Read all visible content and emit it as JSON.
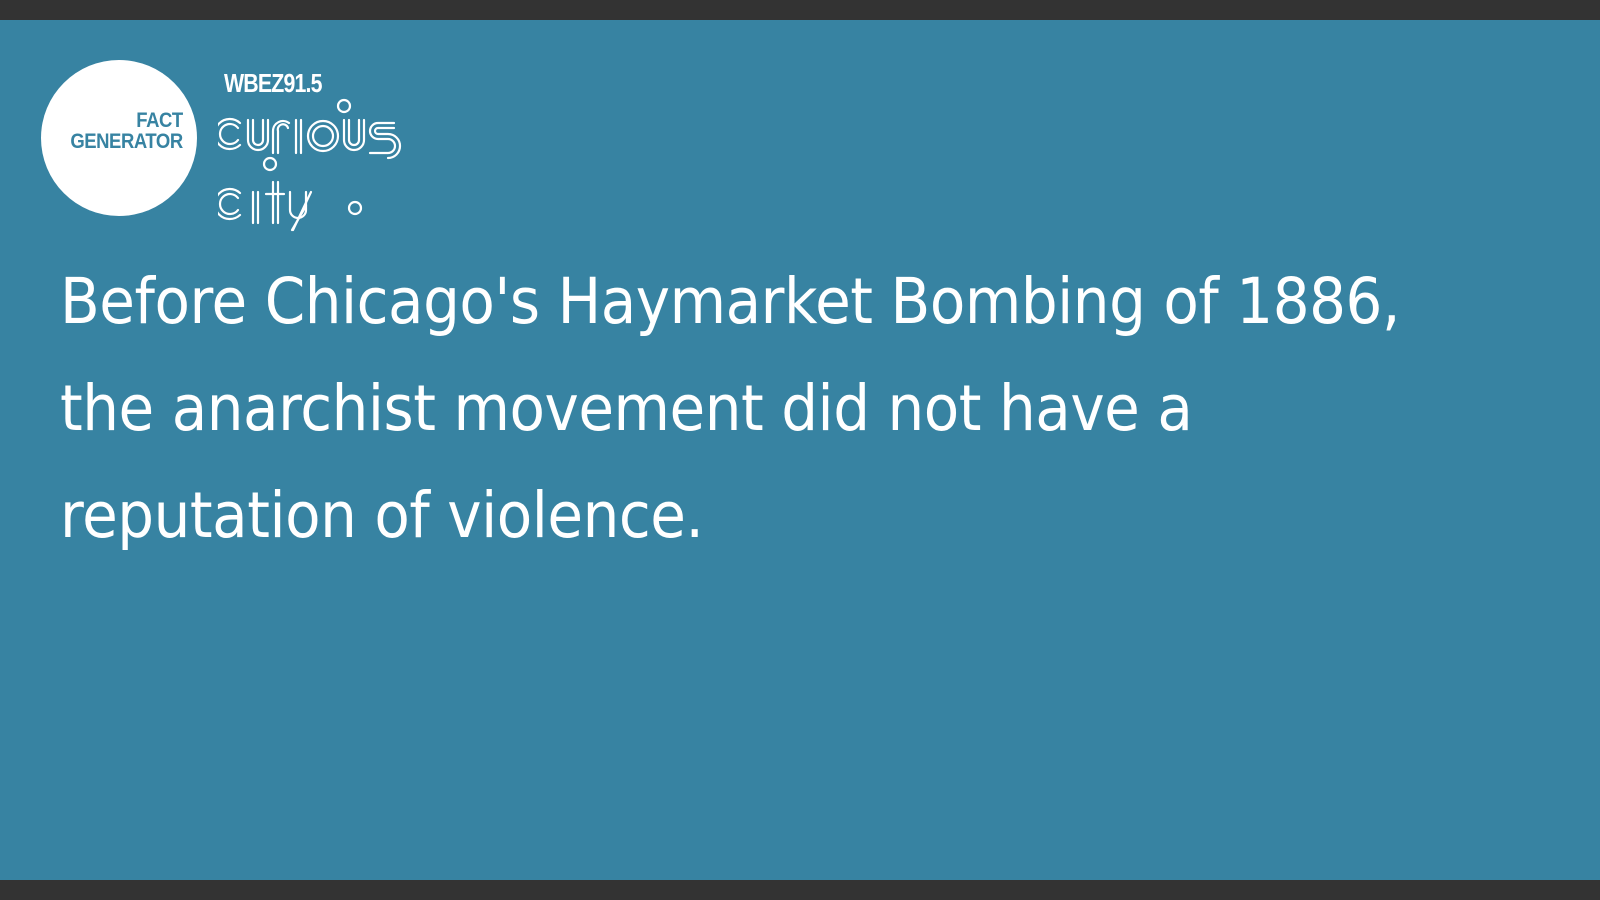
{
  "badge": {
    "line1": "FACT",
    "line2": "GENERATOR"
  },
  "brand": {
    "station": "WBEZ91.5",
    "logo_word1": "curious",
    "logo_word2": "city"
  },
  "fact": {
    "text": "Before Chicago's Haymarket Bombing of 1886, the anarchist movement did not have a reputation of violence."
  },
  "colors": {
    "background": "#3783a2",
    "frame_bars": "#333333",
    "text": "#ffffff"
  }
}
